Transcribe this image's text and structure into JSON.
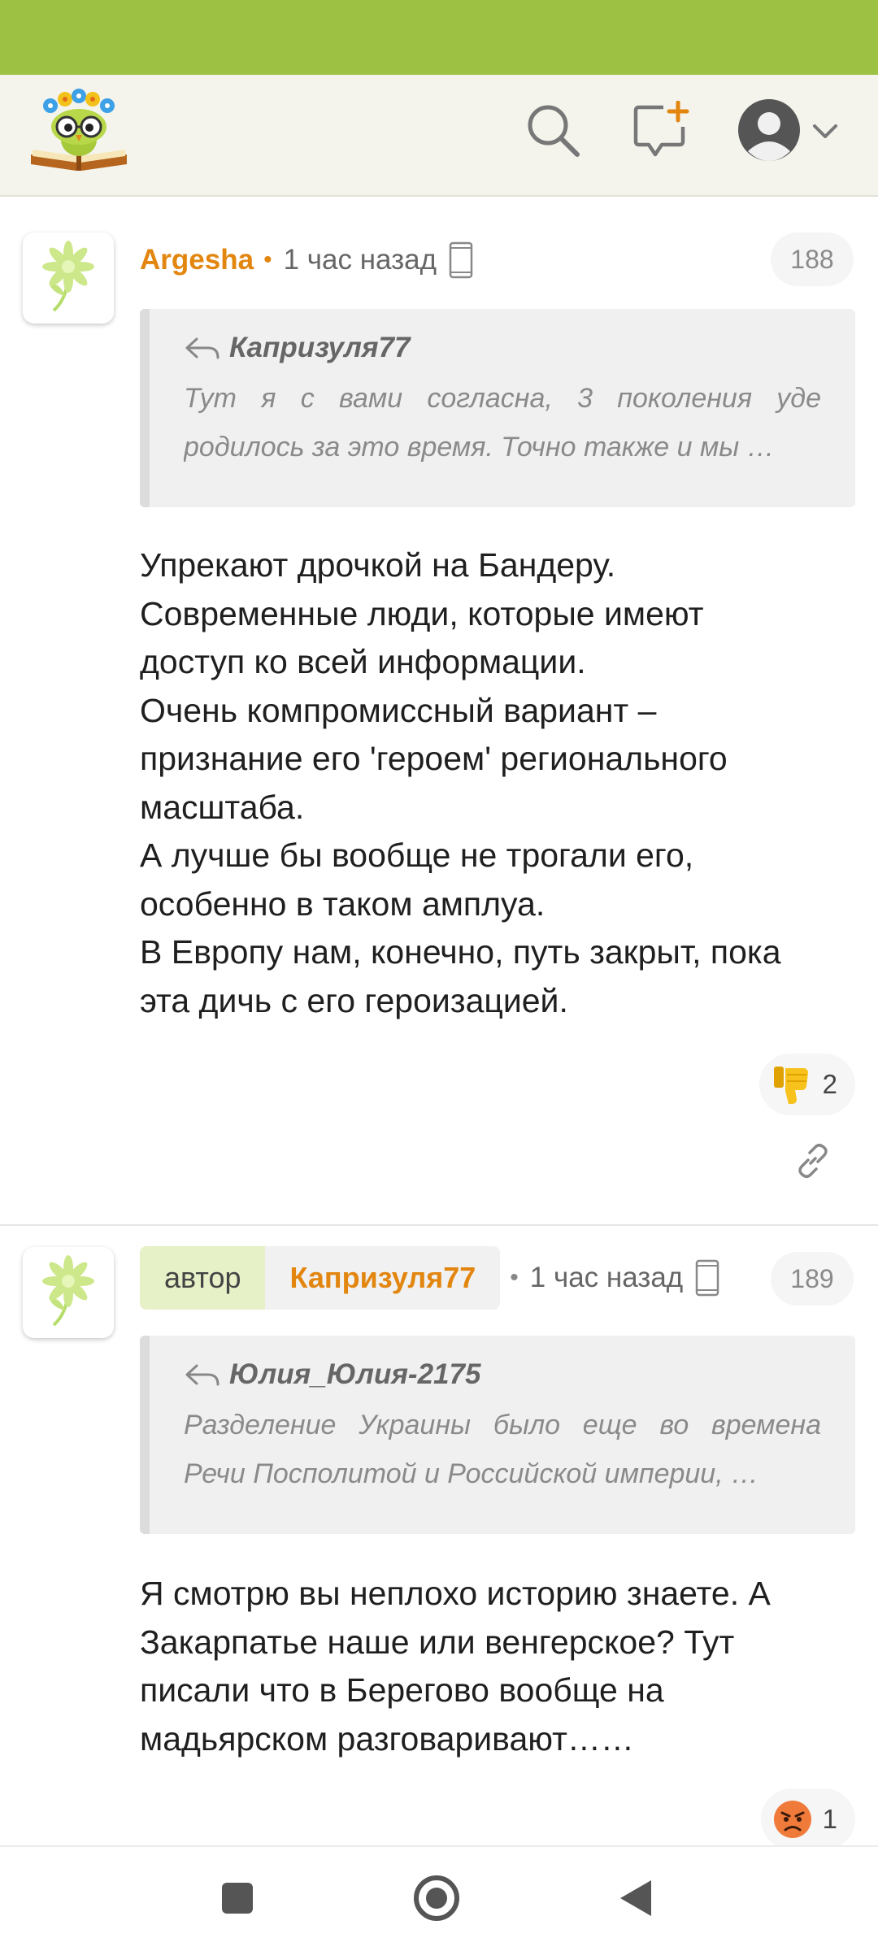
{
  "app": {
    "logo_icon": "book-owl-logo-icon",
    "colors": {
      "status_bar": "#9dc143",
      "accent": "#e2860f",
      "author_tag_bg": "#e6f1c7"
    }
  },
  "header": {
    "icons": [
      "search-icon",
      "new-post-icon",
      "avatar-icon",
      "chevron-down-icon"
    ]
  },
  "comments": [
    {
      "username": "Argesha",
      "time": "1 час назад",
      "device_icon": "phone-icon",
      "number": "188",
      "quote": {
        "author": "Капризуля77",
        "lines": [
          "Тут я с вами согласна, 3 поколения уде",
          "родилось за это время. Точно также и мы …"
        ]
      },
      "text_lines": [
        "Упрекают дрочкой на Бандеру.",
        "Современные люди, которые имеют",
        "доступ ко всей информации.",
        "Очень компромиссный вариант –",
        "признание его 'героем' регионального",
        "масштаба.",
        "А лучше бы вообще не трогали его,",
        "особенно в таком амплуа.",
        "В Европу нам, конечно, путь закрыт, пока",
        "эта дичь с его героизацией."
      ],
      "reaction": {
        "icon": "thumbs-down-icon",
        "count": "2"
      }
    },
    {
      "author_tag": "автор",
      "username": "Капризуля77",
      "time": "1 час назад",
      "device_icon": "phone-icon",
      "number": "189",
      "quote": {
        "author": "Юлия_Юлия-2175",
        "lines": [
          "Разделение Украины было еще во времена",
          "Речи Посполитой и Российской империи, …"
        ]
      },
      "text_lines": [
        "Я смотрю вы неплохо историю знаете. А",
        "Закарпатье наше или венгерское? Тут",
        "писали что в Берегово вообще на",
        "мадьярском разговаривают……"
      ],
      "reaction": {
        "icon": "angry-face-icon",
        "count": "1"
      }
    }
  ],
  "navbar": {
    "icons": [
      "recents-icon",
      "home-icon",
      "back-icon"
    ]
  }
}
